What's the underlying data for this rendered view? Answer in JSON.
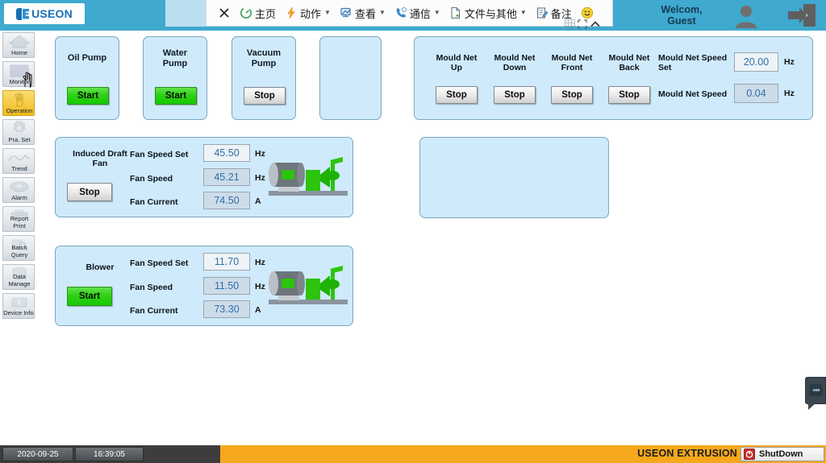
{
  "topbar": {
    "brand": "USEON",
    "welcome_line1": "Welcom,",
    "welcome_line2": "Guest",
    "avatar_icon": "user-avatar-icon",
    "exit_icon": "logout-exit-icon",
    "ribbon": [
      {
        "icon": "close-x-icon",
        "label": "",
        "caret": false
      },
      {
        "icon": "home-circle-icon",
        "label": "主页",
        "caret": false
      },
      {
        "icon": "lightning-icon",
        "label": "动作",
        "caret": true
      },
      {
        "icon": "view-monitor-icon",
        "label": "查看",
        "caret": true
      },
      {
        "icon": "comm-phone-icon",
        "label": "通信",
        "caret": true
      },
      {
        "icon": "file-doc-icon",
        "label": "文件与其他",
        "caret": true
      },
      {
        "icon": "note-pencil-icon",
        "label": "备注",
        "caret": false
      },
      {
        "icon": "smiley-face-icon",
        "label": "",
        "caret": false
      }
    ],
    "corner": {
      "grid_icon": "grid-icon",
      "resize_icon": "resize-diagonal-icon",
      "collapse_icon": "chevron-up-icon"
    }
  },
  "sidebar": {
    "items": [
      {
        "label": "Home",
        "icon": "house-icon",
        "active": false
      },
      {
        "label": "Monitor",
        "icon": "monitor-icon",
        "active": false
      },
      {
        "label": "Operation",
        "icon": "hand-pointer-icon",
        "active": true
      },
      {
        "label": "Pra. Set",
        "icon": "gear-icon",
        "active": false
      },
      {
        "label": "Trend",
        "icon": "trend-wave-icon",
        "active": false
      },
      {
        "label": "Alarm",
        "icon": "alarm-bell-icon",
        "active": false
      },
      {
        "label": "Report Print",
        "icon": "printer-icon",
        "active": false
      },
      {
        "label": "Batch Query",
        "icon": "batch-query-icon",
        "active": false
      },
      {
        "label": "Data Manage",
        "icon": "database-icon",
        "active": false
      },
      {
        "label": "Device Info.",
        "icon": "device-info-icon",
        "active": false
      }
    ]
  },
  "main": {
    "pumps": [
      {
        "title_line1": "Oil Pump",
        "title_line2": "",
        "button": "Start",
        "state": "green"
      },
      {
        "title_line1": "Water",
        "title_line2": "Pump",
        "button": "Start",
        "state": "green"
      },
      {
        "title_line1": "Vacuum",
        "title_line2": "Pump",
        "button": "Stop",
        "state": "gray"
      }
    ],
    "empty_panel_top": "",
    "empty_panel_mid": "",
    "mould_net": {
      "controls": [
        {
          "label_line1": "Mould Net",
          "label_line2": "Up",
          "button": "Stop"
        },
        {
          "label_line1": "Mould Net",
          "label_line2": "Down",
          "button": "Stop"
        },
        {
          "label_line1": "Mould Net",
          "label_line2": "Front",
          "button": "Stop"
        },
        {
          "label_line1": "Mould Net",
          "label_line2": "Back",
          "button": "Stop"
        }
      ],
      "speed_set_label_line1": "Mould Net  Speed",
      "speed_set_label_line2": "Set",
      "speed_set_value": "20.00",
      "speed_set_unit": "Hz",
      "speed_label": "Mould Net  Speed",
      "speed_value": "0.04",
      "speed_unit": "Hz"
    },
    "fans": [
      {
        "name_line1": "Induced Draft",
        "name_line2": "Fan",
        "button": "Stop",
        "state": "gray",
        "rows": [
          {
            "label": "Fan Speed Set",
            "value": "45.50",
            "unit": "Hz",
            "kind": "setp"
          },
          {
            "label": "Fan Speed",
            "value": "45.21",
            "unit": "Hz",
            "kind": "read"
          },
          {
            "label": "Fan Current",
            "value": "74.50",
            "unit": "A",
            "kind": "read"
          }
        ],
        "graphic_icon": "fan-motor-icon"
      },
      {
        "name_line1": "Blower",
        "name_line2": "",
        "button": "Start",
        "state": "green",
        "rows": [
          {
            "label": "Fan Speed Set",
            "value": "11.70",
            "unit": "Hz",
            "kind": "setp"
          },
          {
            "label": "Fan Speed",
            "value": "11.50",
            "unit": "Hz",
            "kind": "read"
          },
          {
            "label": "Fan Current",
            "value": "73.30",
            "unit": "A",
            "kind": "read"
          }
        ],
        "graphic_icon": "fan-motor-icon"
      }
    ]
  },
  "edge_tab": {
    "icon": "drawer-handle-icon"
  },
  "statusbar": {
    "date": "2020-09-25",
    "time": "16:39:05",
    "brand": "USEON EXTRUSION",
    "shutdown_label": "ShutDown",
    "shutdown_icon": "power-icon"
  },
  "colors": {
    "header_blue": "#3fa9cf",
    "panel_fill": "#cfeafb",
    "panel_border": "#7aa7c0",
    "accent_yellow": "#f5a81c",
    "active_nav": "#f6c93d",
    "value_text": "#2f6ea8",
    "start_green": "#2fd215"
  }
}
